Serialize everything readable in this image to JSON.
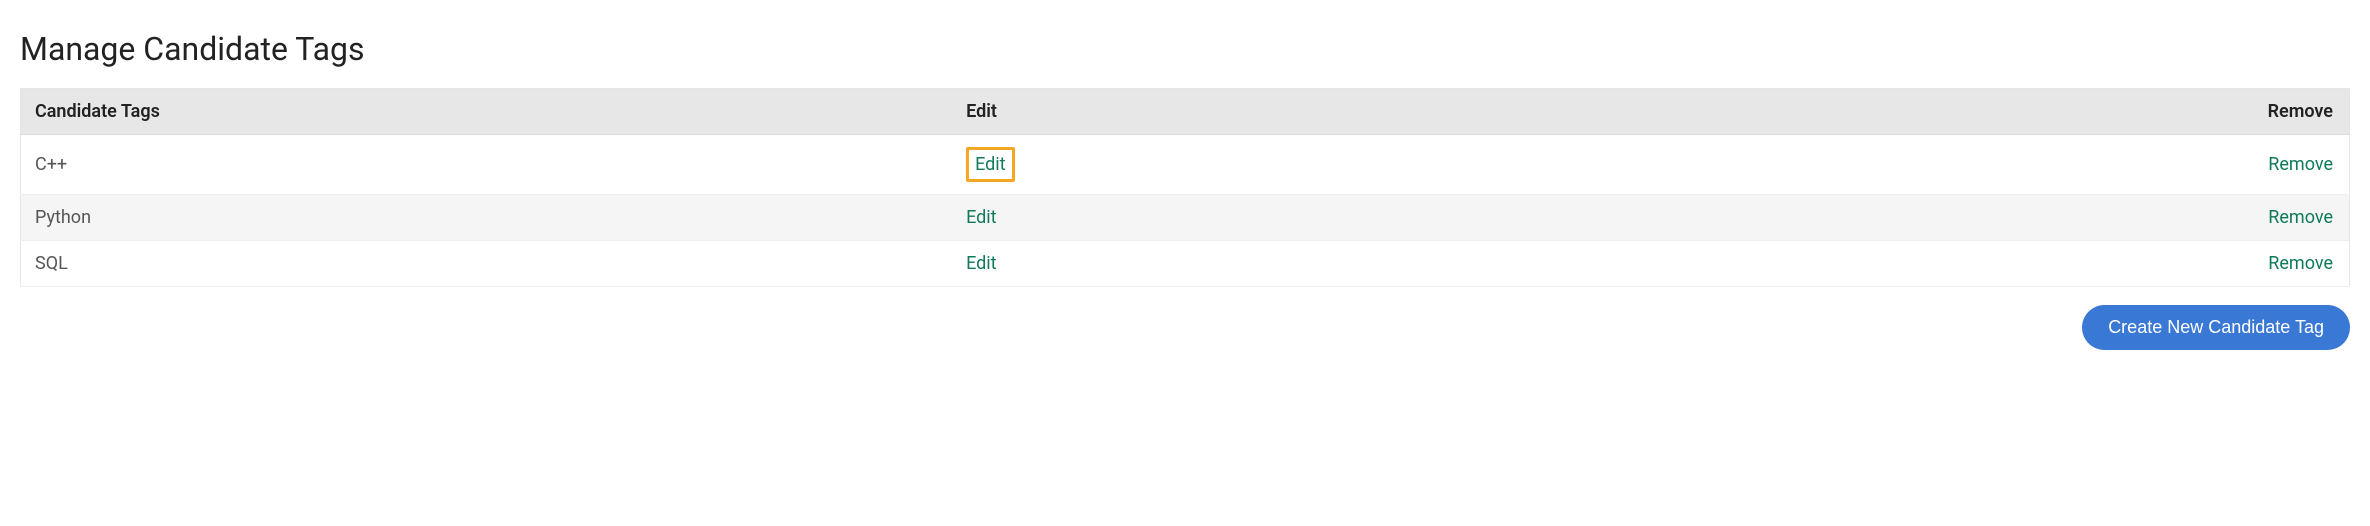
{
  "page": {
    "title": "Manage Candidate Tags"
  },
  "table": {
    "headers": {
      "tags": "Candidate Tags",
      "edit": "Edit",
      "remove": "Remove"
    },
    "rows": [
      {
        "name": "C++",
        "edit_label": "Edit",
        "remove_label": "Remove",
        "highlighted": true
      },
      {
        "name": "Python",
        "edit_label": "Edit",
        "remove_label": "Remove",
        "highlighted": false
      },
      {
        "name": "SQL",
        "edit_label": "Edit",
        "remove_label": "Remove",
        "highlighted": false
      }
    ]
  },
  "actions": {
    "create_new": "Create New Candidate Tag"
  }
}
